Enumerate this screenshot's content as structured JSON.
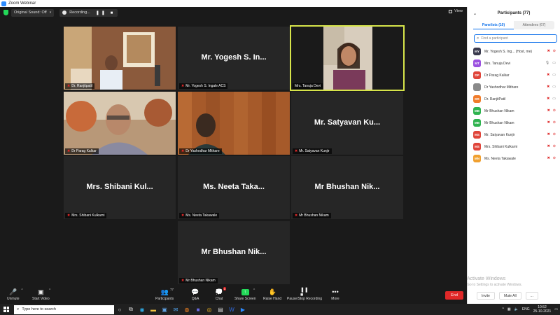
{
  "window": {
    "title": "Zoom Webinar"
  },
  "topbar": {
    "audio_label": "Original Sound: Off",
    "recording_label": "Recording...",
    "recording_controls": "❚❚ ■",
    "view_label": "View"
  },
  "tiles": [
    {
      "label": "Dr. Ranjitpatil",
      "big": ""
    },
    {
      "label": "Mr. Yogesh S. Ingale ACS",
      "big": "Mr. Yogesh S. In..."
    },
    {
      "label": "Mrs. Tanuja Devi",
      "big": ""
    },
    {
      "label": "Dr Parag Kalkar",
      "big": ""
    },
    {
      "label": "Dr Yashodhar Mithare",
      "big": ""
    },
    {
      "label": "Mr. Satyavan Kunjir",
      "big": "Mr. Satyavan Ku..."
    },
    {
      "label": "Mrs. Shibani Kulkarni",
      "big": "Mrs. Shibani Kul..."
    },
    {
      "label": "Ms. Neeta Takawale",
      "big": "Ms. Neeta Taka..."
    },
    {
      "label": "Mr Bhushan Nikam",
      "big": "Mr Bhushan Nik..."
    },
    {
      "label": "Mr Bhushan Nikam",
      "big": "Mr Bhushan Nik..."
    }
  ],
  "toolbar": {
    "unmute": "Unmute",
    "start_video": "Start Video",
    "participants": "Participants",
    "participants_count": "77",
    "qa": "Q&A",
    "chat": "Chat",
    "chat_badge": "1",
    "share_screen": "Share Screen",
    "raise_hand": "Raise Hand",
    "pause_recording": "Pause/Stop Recording",
    "more": "More",
    "end": "End"
  },
  "panel": {
    "title": "Participants (77)",
    "tab_panelists": "Panelists (10)",
    "tab_attendees": "Attendees (67)",
    "search_placeholder": "Find a participant",
    "participants": [
      {
        "initials": "MY",
        "name": "Mr. Yogesh S. Ing... (Host, me)",
        "color": "#3a3a4e",
        "mic_on": false,
        "video_on": false
      },
      {
        "initials": "MT",
        "name": "Mrs. Tanuja Devi",
        "color": "#9b51e0",
        "mic_on": true,
        "video_on": true
      },
      {
        "initials": "DP",
        "name": "Dr Parag Kalkar",
        "color": "#e0453a",
        "mic_on": false,
        "video_on": true
      },
      {
        "initials": "",
        "name": "Dr Yashodhar Mithare",
        "color": "#8a8a8a",
        "mic_on": false,
        "video_on": true
      },
      {
        "initials": "DR",
        "name": "Dr. RanjitPatil",
        "color": "#f07c2b",
        "mic_on": false,
        "video_on": true
      },
      {
        "initials": "MB",
        "name": "Mr Bhushan Nikam",
        "color": "#2fb34f",
        "mic_on": false,
        "video_on": false
      },
      {
        "initials": "MB",
        "name": "Mr Bhushan Nikam",
        "color": "#2fb34f",
        "mic_on": false,
        "video_on": false
      },
      {
        "initials": "MS",
        "name": "Mr. Satyavan Kunjir",
        "color": "#e0453a",
        "mic_on": false,
        "video_on": false
      },
      {
        "initials": "MS",
        "name": "Mrs. Shibani Kulkarni",
        "color": "#e0453a",
        "mic_on": false,
        "video_on": false
      },
      {
        "initials": "MN",
        "name": "Ms. Neeta Takawale",
        "color": "#f0a030",
        "mic_on": false,
        "video_on": false
      }
    ],
    "invite": "Invite",
    "mute_all": "Mute All",
    "more": "..."
  },
  "watermark": {
    "line1": "Activate Windows",
    "line2": "Go to Settings to activate Windows."
  },
  "taskbar": {
    "search_placeholder": "Type here to search",
    "lang": "ENG",
    "time": "10:52",
    "date": "25-10-2021"
  }
}
